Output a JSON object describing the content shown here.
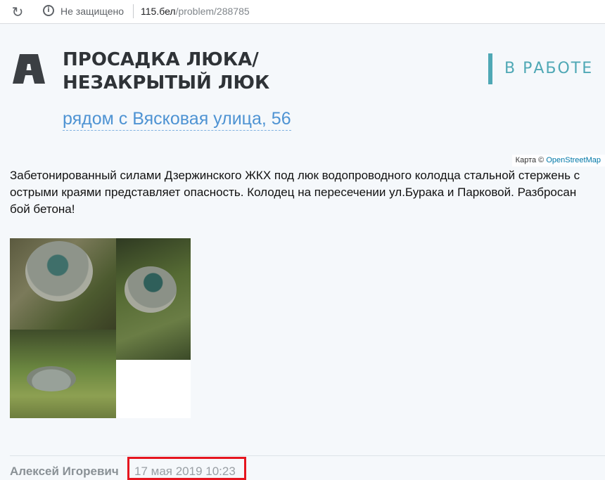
{
  "browser": {
    "reload_icon": "reload-icon",
    "security_icon": "info-icon",
    "security_label": "Не защищено",
    "url_domain": "115.бел",
    "url_path": "/problem/288785"
  },
  "problem": {
    "logo_icon": "category-logo-icon",
    "title": "ПРОСАДКА ЛЮКА/НЕЗАКРЫТЫЙ ЛЮК",
    "status": "В РАБОТЕ",
    "address": "рядом с Вясковая улица, 56",
    "description": "Забетонированный силами Дзержинского ЖКХ под люк водопроводного колодца стальной стержень с острыми краями представляет опасность. Колодец на пересечении ул.Бурака и Парковой. Разбросан бой бетона!"
  },
  "map_credit": {
    "prefix": "Карта ©",
    "link": "OpenStreetMap"
  },
  "footer": {
    "author": "Алексей Игоревич",
    "date": "17 мая 2019 10:23"
  },
  "colors": {
    "accent": "#4fa8b5",
    "link": "#4e93d3",
    "highlight": "#e5151f"
  }
}
